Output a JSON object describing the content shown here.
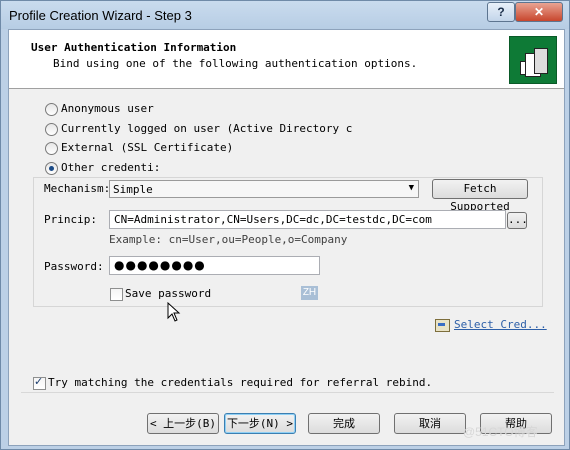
{
  "window": {
    "title": "Profile Creation Wizard - Step 3",
    "help_label": "?",
    "close_label": "✕"
  },
  "header": {
    "title": "User Authentication Information",
    "subtitle": "Bind using one of the following authentication options."
  },
  "auth_options": [
    {
      "label": "Anonymous user",
      "checked": false
    },
    {
      "label": "Currently logged on user (Active Directory c",
      "checked": false
    },
    {
      "label": "External (SSL Certificate)",
      "checked": false
    },
    {
      "label": "Other credenti:",
      "checked": true
    }
  ],
  "mechanism": {
    "label": "Mechanism:",
    "value": "Simple",
    "fetch_label": "Fetch Supported"
  },
  "principal": {
    "label": "Princip:",
    "value": "CN=Administrator,CN=Users,DC=dc,DC=testdc,DC=com",
    "browse_label": "...",
    "example": "Example: cn=User,ou=People,o=Company"
  },
  "password": {
    "label": "Password:",
    "value": "●●●●●●●●"
  },
  "save_password": {
    "label": "Save password",
    "checked": false
  },
  "ime_indicator": "ZH",
  "select_cred_link": "Select Cred...",
  "referral": {
    "label": "Try matching the credentials required for referral rebind.",
    "checked": true
  },
  "buttons": {
    "back": "< 上一步(B)",
    "next": "下一步(N) >",
    "finish": "完成",
    "cancel": "取消",
    "help": "帮助"
  },
  "watermark": "@51CTO博客"
}
